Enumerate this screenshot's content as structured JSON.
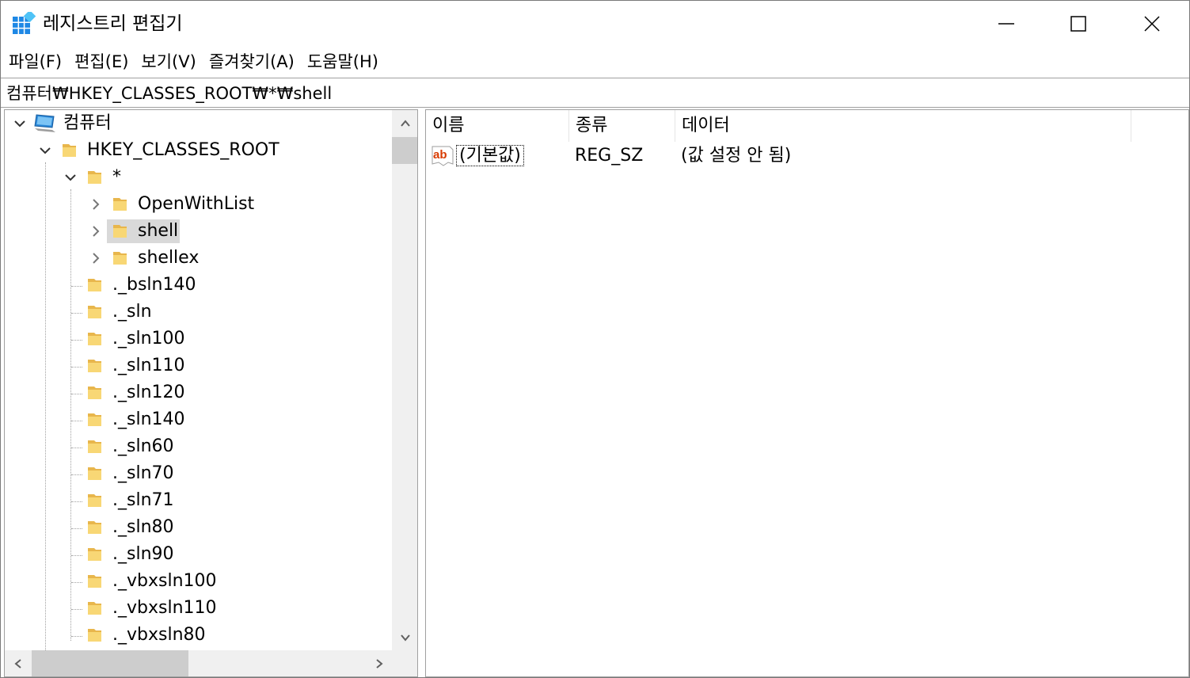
{
  "window": {
    "title": "레지스트리 편집기",
    "app_icon": "registry-editor-icon",
    "controls": [
      "minimize-icon",
      "maximize-icon",
      "close-icon"
    ]
  },
  "menu": [
    {
      "label": "파일(F)"
    },
    {
      "label": "편집(E)"
    },
    {
      "label": "보기(V)"
    },
    {
      "label": "즐겨찾기(A)"
    },
    {
      "label": "도움말(H)"
    }
  ],
  "address": {
    "path": "컴퓨터₩HKEY_CLASSES_ROOT₩*₩shell"
  },
  "tree": {
    "selected": "shell",
    "items": [
      {
        "label": "컴퓨터",
        "level": 0,
        "expander": "expanded",
        "icon": "computer-icon"
      },
      {
        "label": "HKEY_CLASSES_ROOT",
        "level": 1,
        "expander": "expanded",
        "icon": "folder-icon"
      },
      {
        "label": "*",
        "level": 2,
        "expander": "expanded",
        "icon": "folder-icon"
      },
      {
        "label": "OpenWithList",
        "level": 3,
        "expander": "collapsed",
        "icon": "folder-icon"
      },
      {
        "label": "shell",
        "level": 3,
        "expander": "collapsed",
        "icon": "folder-icon",
        "selected": true
      },
      {
        "label": "shellex",
        "level": 3,
        "expander": "collapsed",
        "icon": "folder-icon"
      },
      {
        "label": "._bsln140",
        "level": 2,
        "expander": "none",
        "icon": "folder-icon"
      },
      {
        "label": "._sln",
        "level": 2,
        "expander": "none",
        "icon": "folder-icon"
      },
      {
        "label": "._sln100",
        "level": 2,
        "expander": "none",
        "icon": "folder-icon"
      },
      {
        "label": "._sln110",
        "level": 2,
        "expander": "none",
        "icon": "folder-icon"
      },
      {
        "label": "._sln120",
        "level": 2,
        "expander": "none",
        "icon": "folder-icon"
      },
      {
        "label": "._sln140",
        "level": 2,
        "expander": "none",
        "icon": "folder-icon"
      },
      {
        "label": "._sln60",
        "level": 2,
        "expander": "none",
        "icon": "folder-icon"
      },
      {
        "label": "._sln70",
        "level": 2,
        "expander": "none",
        "icon": "folder-icon"
      },
      {
        "label": "._sln71",
        "level": 2,
        "expander": "none",
        "icon": "folder-icon"
      },
      {
        "label": "._sln80",
        "level": 2,
        "expander": "none",
        "icon": "folder-icon"
      },
      {
        "label": "._sln90",
        "level": 2,
        "expander": "none",
        "icon": "folder-icon"
      },
      {
        "label": "._vbxsln100",
        "level": 2,
        "expander": "none",
        "icon": "folder-icon"
      },
      {
        "label": "._vbxsln110",
        "level": 2,
        "expander": "none",
        "icon": "folder-icon"
      },
      {
        "label": "._vbxsln80",
        "level": 2,
        "expander": "none",
        "icon": "folder-icon"
      }
    ]
  },
  "values_list": {
    "columns": [
      "이름",
      "종류",
      "데이터"
    ],
    "rows": [
      {
        "icon": "string-value-icon",
        "icon_text": "ab",
        "name": "(기본값)",
        "type": "REG_SZ",
        "data": "(값 설정 안 됨)"
      }
    ]
  },
  "colors": {
    "folder": "#f2c94c",
    "selection": "#d9d9d9",
    "scroll_track": "#f0f0f0",
    "scroll_thumb": "#cdcdcd",
    "ab_icon_text": "#d83b01"
  }
}
